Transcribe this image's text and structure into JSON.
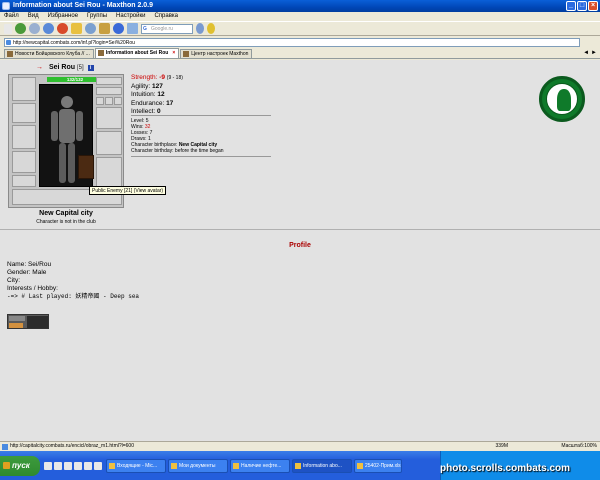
{
  "window": {
    "title": "Information about Sei Rou - Maxthon 2.0.9"
  },
  "menu": [
    "Файл",
    "Вид",
    "Избранное",
    "Группы",
    "Настройки",
    "Справка"
  ],
  "toolbar": {
    "search_placeholder": "Google.ru"
  },
  "address": {
    "url": "http://newcapital.combats.com/inf.pl?login=Sei%20Rou"
  },
  "tabs": [
    {
      "label": "Новости Бойцовского Клуба // ...",
      "active": false
    },
    {
      "label": "Information about Sei Rou",
      "active": true
    },
    {
      "label": "Центр настроек Maxthon",
      "active": false
    }
  ],
  "character": {
    "hp": "132/132",
    "name": "Sei Rou",
    "level_tag": "[5]",
    "info_icon": "i",
    "tooltip": "Public Enemy [21] (View avatar)",
    "city": "New Capital city",
    "club_note": "Character is not in the club"
  },
  "stats": {
    "strength_label": "Strength:",
    "strength_value": "-9",
    "strength_extra": "(9 - 18)",
    "agility_label": "Agility:",
    "agility_value": "127",
    "intuition_label": "Intuition:",
    "intuition_value": "12",
    "endurance_label": "Endurance:",
    "endurance_value": "17",
    "intellect_label": "Intellect:",
    "intellect_value": "0"
  },
  "misc": {
    "level": "Level: 5",
    "wins_label": "Wins:",
    "wins_value": "32",
    "losses": "Losses: 7",
    "draws": "Draws: 1",
    "birthplace_label": "Character birthplace:",
    "birthplace_value": "New Capital city",
    "birthday": "Character birthday: before the time began"
  },
  "profile": {
    "title": "Profile",
    "name": "Name: Sei/Rou",
    "gender": "Gender: Male",
    "city": "City:",
    "interests": "Interests / Hobby:",
    "last_played": "-=> # Last played: 妖精帝國 - Deep sea"
  },
  "statusbar": {
    "url": "http://capitalcity.combats.ru/encicl/obraz_m1.html?l=600",
    "memory": "339M",
    "zoom": "Масштаб:100%"
  },
  "taskbar": {
    "start": "пуск",
    "buttons": [
      {
        "label": "Входящие - Mic...",
        "active": false
      },
      {
        "label": "Мои документы",
        "active": false
      },
      {
        "label": "Наличие нефте...",
        "active": false
      },
      {
        "label": "Information abo...",
        "active": true
      },
      {
        "label": "25402-Прим.xls",
        "active": false
      }
    ]
  },
  "watermark": "photo.scrolls.combats.com",
  "colors": {
    "accent_red": "#cc0000",
    "profile_title": "#aa0000",
    "hp_green": "#2fbf2f",
    "logo_green": "#0f7a2a"
  }
}
